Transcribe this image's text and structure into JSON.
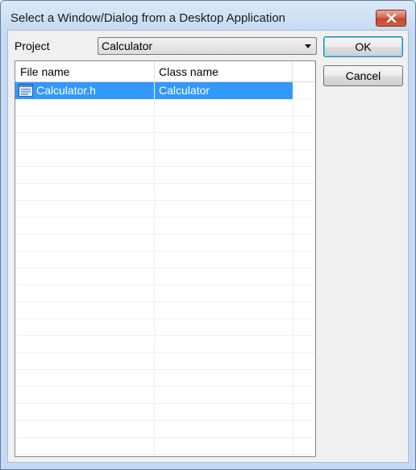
{
  "window": {
    "title": "Select a Window/Dialog from a Desktop Application"
  },
  "project": {
    "label": "Project",
    "selected": "Calculator"
  },
  "buttons": {
    "ok": "OK",
    "cancel": "Cancel"
  },
  "table": {
    "columns": [
      "File name",
      "Class name"
    ],
    "rows": [
      {
        "file": "Calculator.h",
        "class": "Calculator",
        "selected": true
      }
    ]
  },
  "icons": {
    "close": "close-icon",
    "dropdown": "chevron-down-icon",
    "file": "header-file-icon"
  },
  "colors": {
    "selection": "#3399ff",
    "frame": "#c6dbf2"
  }
}
